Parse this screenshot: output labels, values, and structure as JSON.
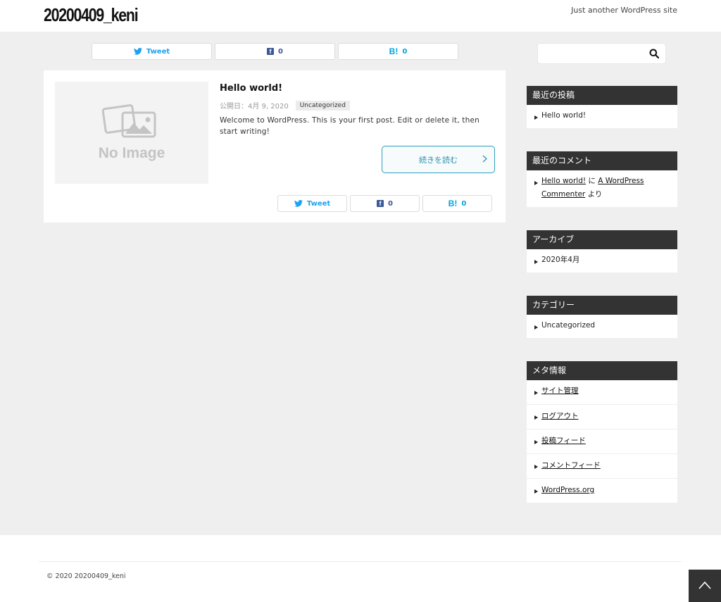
{
  "header": {
    "site_title": "20200409_keni",
    "tagline": "Just another WordPress site"
  },
  "share": {
    "tweet_label": "Tweet",
    "facebook_count": "0",
    "hatena_label": "B!",
    "hatena_count": "0",
    "facebook_icon": "f"
  },
  "post": {
    "title": "Hello world!",
    "date": "公開日：4月 9, 2020",
    "category": "Uncategorized",
    "excerpt": "Welcome to WordPress. This is your first post. Edit or delete it, then start writing!",
    "read_more": "続きを読む",
    "thumbnail_text": "No Image"
  },
  "sidebar": {
    "recent_posts": {
      "title": "最近の投稿",
      "items": [
        "Hello world!"
      ]
    },
    "recent_comments": {
      "title": "最近のコメント",
      "post_link": "Hello world!",
      "on": "に",
      "author_link": "A WordPress Commenter",
      "by": "より"
    },
    "archives": {
      "title": "アーカイブ",
      "items": [
        "2020年4月"
      ]
    },
    "categories": {
      "title": "カテゴリー",
      "items": [
        "Uncategorized"
      ]
    },
    "meta": {
      "title": "メタ情報",
      "items": [
        "サイト管理",
        "ログアウト",
        "投稿フィード",
        "コメントフィード",
        "WordPress.org"
      ]
    }
  },
  "footer": {
    "copyright": "© 2020 20200409_keni"
  },
  "colors": {
    "accent": "#2a9fbe",
    "twitter": "#1da1f2",
    "facebook": "#3b5998",
    "hatena": "#00a4de",
    "widget_header": "#333333"
  },
  "icons": [
    "twitter-icon",
    "facebook-icon",
    "hatena-icon",
    "search-icon",
    "chevron-right-icon",
    "chevron-up-icon",
    "image-placeholder-icon"
  ]
}
